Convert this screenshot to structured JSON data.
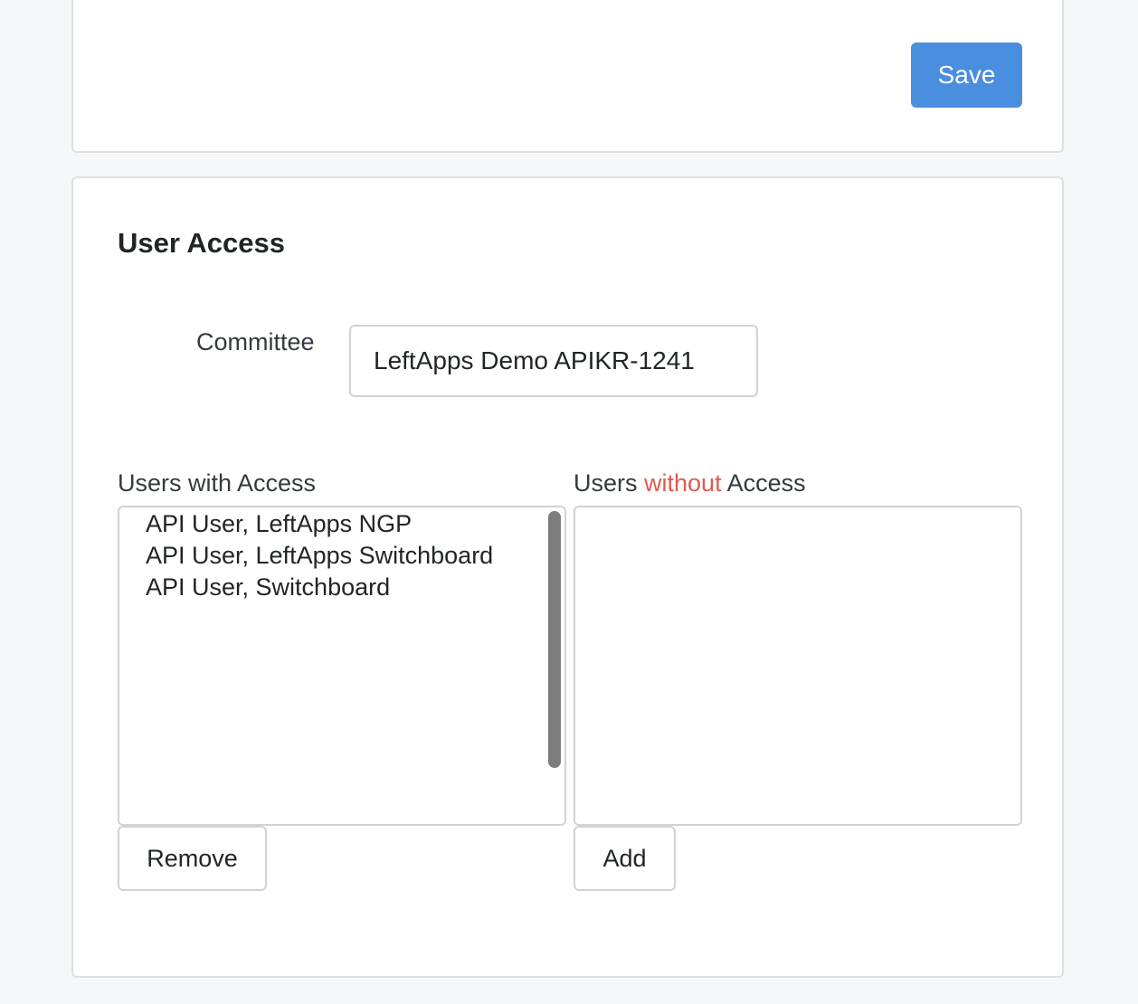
{
  "top_card": {
    "save_label": "Save"
  },
  "user_access": {
    "title": "User Access",
    "committee": {
      "label": "Committee",
      "value": "LeftApps Demo APIKR-1241"
    },
    "with_access": {
      "label": "Users with Access",
      "options": [
        "API User, LeftApps NGP",
        "API User, LeftApps Switchboard",
        "API User, Switchboard"
      ],
      "remove_label": "Remove"
    },
    "without_access": {
      "label_prefix": "Users ",
      "label_highlight": "without",
      "label_suffix": " Access",
      "options": [],
      "add_label": "Add"
    }
  },
  "colors": {
    "primary": "#4a8ee0",
    "warning_text": "#e05a4f",
    "border": "#cfd3d8",
    "page_background": "#f6f7f9"
  }
}
